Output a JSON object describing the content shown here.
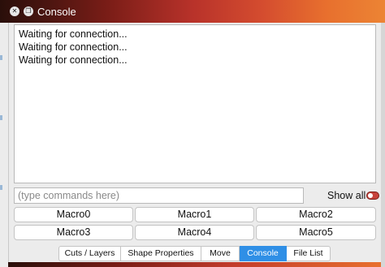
{
  "window": {
    "title": "Console",
    "close_glyph": "✕",
    "float_glyph": "❐"
  },
  "console": {
    "lines": [
      "Waiting for connection...",
      "Waiting for connection...",
      "Waiting for connection..."
    ]
  },
  "command": {
    "value": "",
    "placeholder": "(type commands here)"
  },
  "show_all": {
    "label": "Show all",
    "enabled": false
  },
  "macros": [
    "Macro0",
    "Macro1",
    "Macro2",
    "Macro3",
    "Macro4",
    "Macro5"
  ],
  "tabs": [
    {
      "label": "Cuts / Layers",
      "active": false
    },
    {
      "label": "Shape Properties",
      "active": false
    },
    {
      "label": "Move",
      "active": false
    },
    {
      "label": "Console",
      "active": true
    },
    {
      "label": "File List",
      "active": false
    }
  ],
  "colors": {
    "accent_tab": "#2f8fe6",
    "toggle": "#c7433c",
    "titlebar_start": "#2a0f0a",
    "titlebar_end": "#ec8434"
  }
}
